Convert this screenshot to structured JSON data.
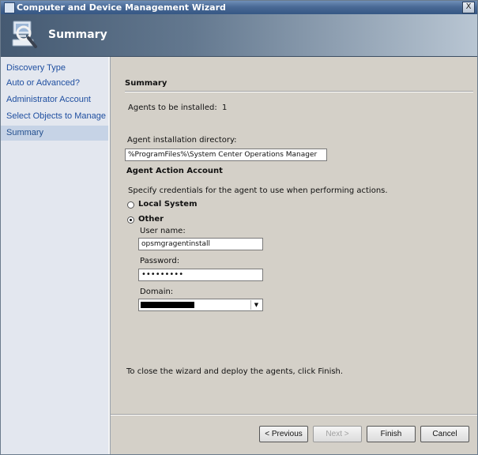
{
  "window": {
    "title": "Computer and Device Management Wizard",
    "close_glyph": "X"
  },
  "header": {
    "title": "Summary",
    "icon": "magnifier-computer-icon"
  },
  "nav": {
    "items": [
      {
        "label": "Discovery Type",
        "selected": false
      },
      {
        "label": "Auto or Advanced?",
        "selected": false
      },
      {
        "label": "Administrator Account",
        "selected": false
      },
      {
        "label": "Select Objects to Manage",
        "selected": false
      },
      {
        "label": "Summary",
        "selected": true
      }
    ]
  },
  "summary": {
    "section_title": "Summary",
    "agents_label": "Agents to be installed:",
    "agents_value": "1",
    "dir_label": "Agent installation directory:",
    "dir_value": "%ProgramFiles%\\System Center Operations Manager"
  },
  "account": {
    "section_title": "Agent Action Account",
    "description": "Specify credentials for the agent to use when performing actions.",
    "local_system_label": "Local System",
    "other_label": "Other",
    "selected_option": "Other",
    "username_label": "User name:",
    "username_value": "opsmgragentinstall",
    "password_label": "Password:",
    "password_value": "•••••••••",
    "domain_label": "Domain:"
  },
  "footer_text": "To close the wizard and deploy the agents, click Finish.",
  "buttons": {
    "previous": "< Previous",
    "next": "Next >",
    "finish": "Finish",
    "cancel": "Cancel"
  },
  "colors": {
    "nav_link": "#1f4fa0",
    "nav_selected_bg": "#c6d3e6",
    "title_bar": "#4a6a96"
  }
}
